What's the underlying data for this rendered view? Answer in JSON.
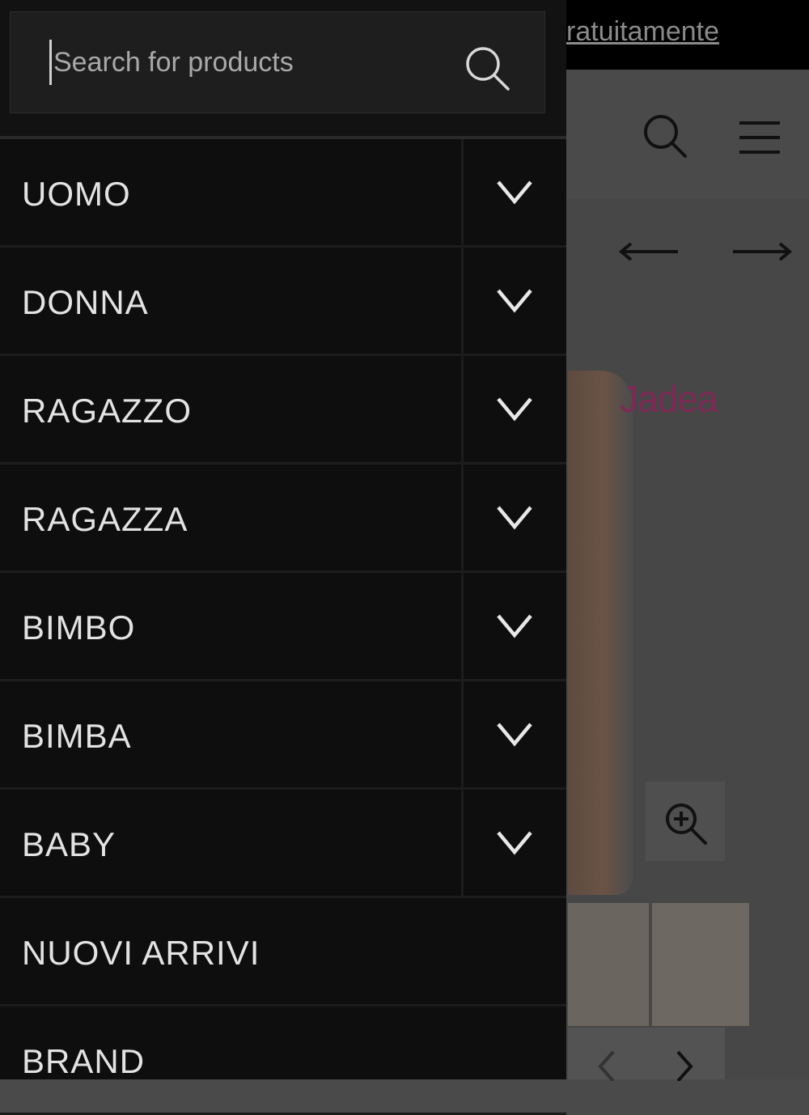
{
  "background_page": {
    "promo_link": "Spedizione gratuitamente",
    "promo_visible": "ratuitamente",
    "brand_logo": "Jadea",
    "icons": {
      "search": "search-icon",
      "menu": "hamburger-menu-icon",
      "prev": "arrow-left-icon",
      "next": "arrow-right-icon",
      "zoom": "zoom-in-icon",
      "thumb_prev": "chevron-left-icon",
      "thumb_next": "chevron-right-icon"
    }
  },
  "drawer": {
    "search": {
      "placeholder": "Search for products",
      "value": "",
      "icon": "search-icon"
    },
    "menu_items": [
      {
        "label": "UOMO",
        "expandable": true
      },
      {
        "label": "DONNA",
        "expandable": true
      },
      {
        "label": "RAGAZZO",
        "expandable": true
      },
      {
        "label": "RAGAZZA",
        "expandable": true
      },
      {
        "label": "BIMBO",
        "expandable": true
      },
      {
        "label": "BIMBA",
        "expandable": true
      },
      {
        "label": "BABY",
        "expandable": true
      },
      {
        "label": "NUOVI ARRIVI",
        "expandable": false
      },
      {
        "label": "BRAND",
        "expandable": false
      }
    ]
  },
  "colors": {
    "drawer_bg": "#0e0e0e",
    "overlay": "#4a4a4a",
    "text": "#e3e3e3",
    "brand_logo": "#7d2a55"
  }
}
